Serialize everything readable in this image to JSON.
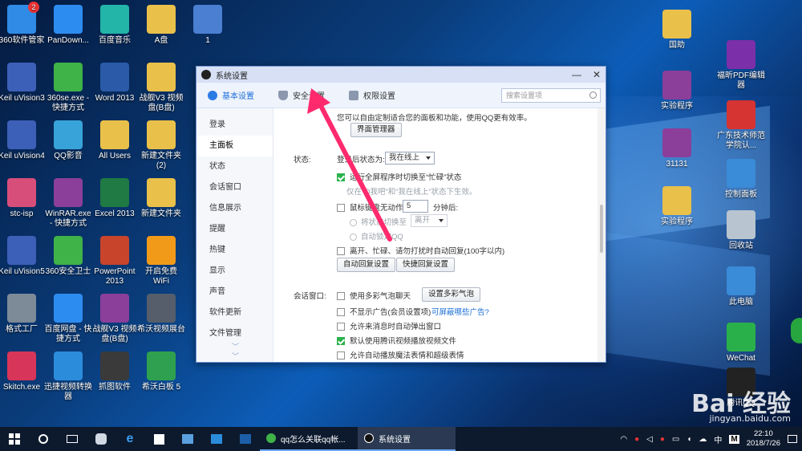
{
  "desktop": {
    "left_icons": [
      {
        "label": "360软件管家",
        "badge": "2",
        "color": "#2f8be6",
        "icon": "360-manager-icon"
      },
      {
        "label": "PanDown...",
        "badge": "",
        "color": "#2d8cf0",
        "icon": "cloud-icon"
      },
      {
        "label": "百度音乐",
        "badge": "",
        "color": "#22b5a8",
        "icon": "headphones-icon"
      },
      {
        "label": "A盘",
        "badge": "",
        "color": "#e9c04a",
        "icon": "folder-icon"
      },
      {
        "label": "1",
        "badge": "",
        "color": "#4a7fd1",
        "icon": "file-icon"
      },
      {
        "label": "Keil uVision3",
        "badge": "",
        "color": "#3c5fb8",
        "icon": "keil-icon"
      },
      {
        "label": "360se.exe - 快捷方式",
        "badge": "",
        "color": "#3fb248",
        "icon": "360-browser-icon"
      },
      {
        "label": "Word 2013",
        "badge": "",
        "color": "#2a5aa8",
        "icon": "word-icon"
      },
      {
        "label": "战舰V3 视频盘(B盘)",
        "badge": "",
        "color": "#e9c04a",
        "icon": "folder-icon"
      },
      {
        "label": "Keil uVision4",
        "badge": "",
        "color": "#3c5fb8",
        "icon": "keil-icon"
      },
      {
        "label": "QQ影音",
        "badge": "",
        "color": "#38a3d8",
        "icon": "qq-player-icon"
      },
      {
        "label": "All Users",
        "badge": "",
        "color": "#e9c04a",
        "icon": "folder-icon"
      },
      {
        "label": "新建文件夹 (2)",
        "badge": "",
        "color": "#e9c04a",
        "icon": "folder-icon"
      },
      {
        "label": "stc-isp",
        "badge": "",
        "color": "#d84e7a",
        "icon": "stc-isp-icon"
      },
      {
        "label": "WinRAR.exe - 快捷方式",
        "badge": "",
        "color": "#8b3f9a",
        "icon": "winrar-icon"
      },
      {
        "label": "Excel 2013",
        "badge": "",
        "color": "#1f7a43",
        "icon": "excel-icon"
      },
      {
        "label": "新建文件夹",
        "badge": "",
        "color": "#e9c04a",
        "icon": "folder-icon"
      },
      {
        "label": "Keil uVision5",
        "badge": "",
        "color": "#3c5fb8",
        "icon": "keil-icon"
      },
      {
        "label": "360安全卫士",
        "badge": "",
        "color": "#3fb248",
        "icon": "360-security-icon"
      },
      {
        "label": "PowerPoint 2013",
        "badge": "",
        "color": "#c8452b",
        "icon": "powerpoint-icon"
      },
      {
        "label": "开启免费 WiFi",
        "badge": "",
        "color": "#f19a1a",
        "icon": "wifi-icon"
      },
      {
        "label": "格式工厂",
        "badge": "",
        "color": "#7d8a98",
        "icon": "format-factory-icon"
      },
      {
        "label": "百度网盘 - 快捷方式",
        "badge": "",
        "color": "#2d8cf0",
        "icon": "baidu-pan-icon"
      },
      {
        "label": "战舰V3 视频盘(B盘)",
        "badge": "",
        "color": "#8b3f9a",
        "icon": "winrar-icon"
      },
      {
        "label": "希沃视频展台",
        "badge": "",
        "color": "#555e6a",
        "icon": "camera-icon"
      },
      {
        "label": "Skitch.exe",
        "badge": "",
        "color": "#d8355a",
        "icon": "skitch-icon"
      },
      {
        "label": "迅捷视频转换器",
        "badge": "",
        "color": "#2b8cdc",
        "icon": "video-converter-icon"
      },
      {
        "label": "抓图软件",
        "badge": "",
        "color": "#3a3a3a",
        "icon": "screenshot-icon"
      },
      {
        "label": "希沃白板 5",
        "badge": "",
        "color": "#2ea04f",
        "icon": "en-board-icon"
      }
    ],
    "right_icons": [
      {
        "label": "国助",
        "color": "#e9c04a",
        "icon": "folder-icon"
      },
      {
        "label": "福昕PDF编辑器",
        "color": "#7b2fa8",
        "icon": "foxit-pdf-icon"
      },
      {
        "label": "实验程序",
        "color": "#8b3f9a",
        "icon": "winrar-icon"
      },
      {
        "label": "广东技术师范学院认...",
        "color": "#d63333",
        "icon": "campus-auth-icon"
      },
      {
        "label": "31131",
        "color": "#8b3f9a",
        "icon": "winrar-icon"
      },
      {
        "label": "控制面板",
        "color": "#3a8bd8",
        "icon": "control-panel-icon"
      },
      {
        "label": "实验程序",
        "color": "#e9c04a",
        "icon": "folder-icon"
      },
      {
        "label": "回收站",
        "color": "#b8c4cf",
        "icon": "recycle-bin-icon"
      },
      {
        "label": "此电脑",
        "color": "#3a8bd8",
        "icon": "computer-icon"
      },
      {
        "label": "WeChat",
        "color": "#2ab04a",
        "icon": "wechat-icon"
      },
      {
        "label": "腾讯QQ",
        "color": "#222222",
        "icon": "qq-icon"
      }
    ],
    "watermark": "Bai 经验",
    "watermark_url": "jingyan.baidu.com"
  },
  "window": {
    "title": "系统设置",
    "controls": [
      "—",
      "✕"
    ],
    "tabs": [
      {
        "label": "基本设置",
        "active": true,
        "icon": "gear-icon"
      },
      {
        "label": "安全设置",
        "active": false,
        "icon": "shield-icon"
      },
      {
        "label": "权限设置",
        "active": false,
        "icon": "lock-icon"
      }
    ],
    "search_placeholder": "搜索设置项",
    "nav": [
      "登录",
      "主面板",
      "状态",
      "会话窗口",
      "信息展示",
      "提醒",
      "热键",
      "显示",
      "声音",
      "软件更新",
      "文件管理"
    ],
    "nav_active": "主面板",
    "content": {
      "intro": "您可以自由定制适合您的面板和功能，使用QQ更有效率。",
      "panel_manager_btn": "界面管理器",
      "status_label": "状态:",
      "login_status_label": "登录后状态为:",
      "login_status_value": "我在线上",
      "opt_fullscreen": "运行全屏程序时切换至“忙碌”状态",
      "opt_fullscreen_note": "仅在“Q我吧”和“我在线上”状态下生效。",
      "opt_idle": "鼠标键盘无动作",
      "opt_idle_minutes": "5",
      "opt_idle_after": "分钟后:",
      "opt_switch_status": "将状态切换至",
      "opt_switch_value": "离开",
      "opt_auto_lock": "自动锁定QQ",
      "opt_auto_reply": "离开、忙碌、请勿打扰时自动回复(100字以内)",
      "auto_reply_btn": "自动回复设置",
      "quick_reply_btn": "快捷回复设置",
      "session_label": "会话窗口:",
      "opt_multicolor": "使用多彩气泡聊天",
      "multicolor_btn": "设置多彩气泡",
      "opt_no_ads": "不显示广告(会员设置项)",
      "ads_link": "可屏蔽哪些广告?",
      "opt_popup": "允许来消息时自动弹出窗口",
      "opt_video": "默认使用腾讯视频播放视频文件",
      "opt_magic": "允许自动播放魔法表情和超级表情"
    }
  },
  "taskbar": {
    "apps": [
      {
        "label": "qq怎么关联qq帐...",
        "active": false,
        "icon": "360-browser-icon"
      },
      {
        "label": "系统设置",
        "active": true,
        "icon": "qq-icon"
      }
    ],
    "tray_lang": "中",
    "tray_ime": "M",
    "time": "22:10",
    "date": "2018/7/26"
  },
  "colors": {
    "accent": "#1e6fd9",
    "check": "#2bb24c",
    "arrow": "#ff2a6d"
  }
}
